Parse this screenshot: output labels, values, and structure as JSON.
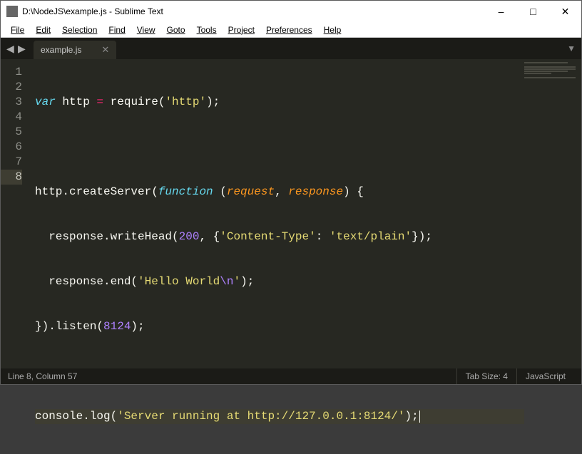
{
  "window": {
    "title": "D:\\NodeJS\\example.js - Sublime Text"
  },
  "menu": [
    "File",
    "Edit",
    "Selection",
    "Find",
    "View",
    "Goto",
    "Tools",
    "Project",
    "Preferences",
    "Help"
  ],
  "tabs": [
    {
      "label": "example.js"
    }
  ],
  "gutter": {
    "lines": [
      "1",
      "2",
      "3",
      "4",
      "5",
      "6",
      "7",
      "8"
    ],
    "active_index": 7
  },
  "code": {
    "l1_a": "var",
    "l1_b": " http ",
    "l1_c": "=",
    "l1_d": " require(",
    "l1_e": "'http'",
    "l1_f": ");",
    "l2": "",
    "l3_a": "http.createServer(",
    "l3_b": "function",
    "l3_c": " (",
    "l3_d": "request",
    "l3_e": ", ",
    "l3_f": "response",
    "l3_g": ") {",
    "l4_a": "  response.writeHead(",
    "l4_b": "200",
    "l4_c": ", {",
    "l4_d": "'Content-Type'",
    "l4_e": ": ",
    "l4_f": "'text/plain'",
    "l4_g": "});",
    "l5_a": "  response.end(",
    "l5_b": "'Hello World",
    "l5_c": "\\n",
    "l5_d": "'",
    "l5_e": ");",
    "l6_a": "}).listen(",
    "l6_b": "8124",
    "l6_c": ");",
    "l7": "",
    "l8_a": "console.log(",
    "l8_b": "'Server running at http://127.0.0.1:8124/'",
    "l8_c": ");"
  },
  "status": {
    "position": "Line 8, Column 57",
    "tab_size": "Tab Size: 4",
    "syntax": "JavaScript"
  }
}
